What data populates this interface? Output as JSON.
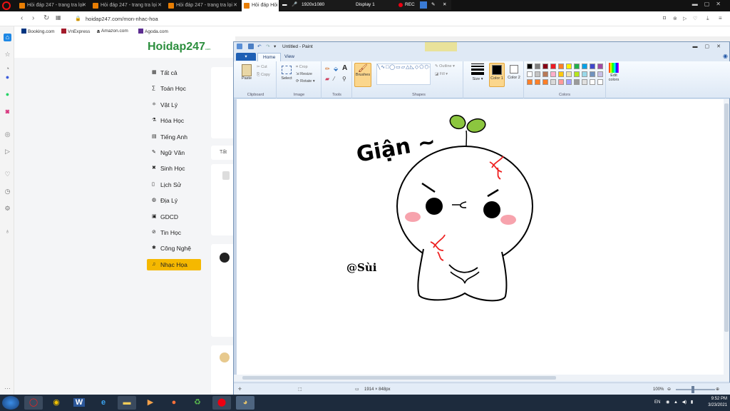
{
  "browser": {
    "tabs": [
      {
        "label": "Hỏi đáp 247 - trang tra lọi"
      },
      {
        "label": "Hỏi đáp 247 - trang tra lọi"
      },
      {
        "label": "Hỏi đáp 247 - trang tra lọi"
      },
      {
        "label": "Hỏi đáp Hỏi"
      }
    ],
    "url": "hoidap247.com/mon-nhac-hoa",
    "bookmarks": [
      "Booking.com",
      "VnExpress",
      "Amazon.com",
      "Agoda.com"
    ]
  },
  "recorder_overlay": {
    "resolution": "1920x1080",
    "display": "Display 1",
    "rec": "REC"
  },
  "site": {
    "logo": "Hoidap247",
    "logo_suffix": "com",
    "subjects": [
      {
        "label": "Tất cả",
        "icon": "grid-icon"
      },
      {
        "label": "Toán Học",
        "icon": "math-icon"
      },
      {
        "label": "Vật Lý",
        "icon": "atom-icon"
      },
      {
        "label": "Hóa Học",
        "icon": "flask-icon"
      },
      {
        "label": "Tiếng Anh",
        "icon": "abc-icon"
      },
      {
        "label": "Ngữ Văn",
        "icon": "pen-icon"
      },
      {
        "label": "Sinh Học",
        "icon": "dna-icon"
      },
      {
        "label": "Lịch Sử",
        "icon": "scroll-icon"
      },
      {
        "label": "Địa Lý",
        "icon": "globe-icon"
      },
      {
        "label": "GDCD",
        "icon": "book-icon"
      },
      {
        "label": "Tin Học",
        "icon": "chip-icon"
      },
      {
        "label": "Công Nghệ",
        "icon": "gear-icon"
      },
      {
        "label": "Nhạc Họa",
        "icon": "music-icon"
      }
    ],
    "active_subject": "Nhạc Họa",
    "filter_partial": "Tất"
  },
  "paint": {
    "title": "Untitled - Paint",
    "file_menu": "▾",
    "tabs": [
      "Home",
      "View"
    ],
    "groups": {
      "clipboard": {
        "label": "Clipboard",
        "paste": "Paste",
        "cut": "Cut",
        "copy": "Copy"
      },
      "image": {
        "label": "Image",
        "select": "Select",
        "crop": "Crop",
        "resize": "Resize",
        "rotate": "Rotate"
      },
      "tools": {
        "label": "Tools"
      },
      "brushes": "Brushes",
      "shapes": {
        "label": "Shapes",
        "outline": "Outline",
        "fill": "Fill"
      },
      "size": "Size",
      "color1": "Color 1",
      "color2": "Color 2",
      "colors": {
        "label": "Colors"
      },
      "edit_colors": "Edit colors"
    },
    "palette": [
      "#000000",
      "#7f7f7f",
      "#880015",
      "#ed1c24",
      "#ff7f27",
      "#fff200",
      "#22b14c",
      "#00a2e8",
      "#3f48cc",
      "#a349a4",
      "#ffffff",
      "#c3c3c3",
      "#b97a57",
      "#ffaec9",
      "#ffc90e",
      "#efe4b0",
      "#b5e61d",
      "#99d9ea",
      "#7092be",
      "#c8bfe7",
      "#ff7f27",
      "#ff7f27",
      "#ff7f27",
      "#d9d9d9",
      "#ff9a9a",
      "#a0a0ff",
      "#9a9a9a",
      "#e0e0e0",
      "#ffffff",
      "#ffffff"
    ],
    "drawing": {
      "caption": "Giận ~",
      "signature": "@Sùi"
    },
    "status": {
      "dimensions": "1914 × 848px",
      "zoom": "100%"
    }
  },
  "taskbar": {
    "time": "9:52 PM",
    "date": "3/23/2021",
    "lang": "EN"
  }
}
